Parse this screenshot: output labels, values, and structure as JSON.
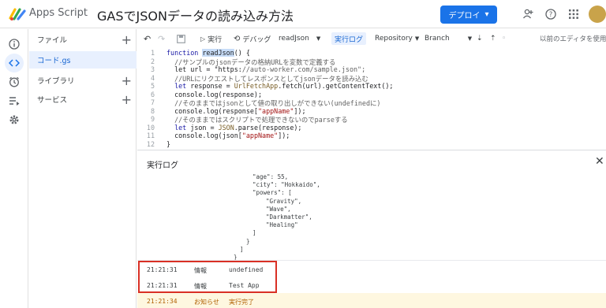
{
  "header": {
    "app_name": "Apps Script",
    "project_title": "GASでJSONデータの読み込み方法",
    "deploy_label": "デプロイ",
    "icons": [
      "add-person-icon",
      "help-icon",
      "apps-grid-icon",
      "avatar"
    ]
  },
  "rail": [
    "info-icon",
    "code-icon",
    "clock-icon",
    "run-list-icon",
    "settings-icon"
  ],
  "sidebar": {
    "files_label": "ファイル",
    "file_name": "コード.gs",
    "libraries_label": "ライブラリ",
    "services_label": "サービス"
  },
  "toolbar": {
    "run_label": "実行",
    "debug_label": "デバッグ",
    "function_name": "readJson",
    "exec_log_label": "実行ログ",
    "repository_label": "Repository",
    "branch_label": "Branch",
    "legacy_editor_label": "以前のエディタを使用"
  },
  "code": [
    {
      "n": "1",
      "text": "function readJson() {"
    },
    {
      "n": "2",
      "text": "  //サンプルのjsonデータの格納URLを変数で定義する"
    },
    {
      "n": "3",
      "text": "  let url = \"https://auto-worker.com/sample.json\";"
    },
    {
      "n": "4",
      "text": "  //URLにリクエストしてレスポンスとしてjsonデータを読み込む"
    },
    {
      "n": "5",
      "text": "  let response = UrlFetchApp.fetch(url).getContentText();"
    },
    {
      "n": "6",
      "text": "  console.log(response);"
    },
    {
      "n": "7",
      "text": "  //そのままではjsonとして値の取り出しができない(undefinedに)"
    },
    {
      "n": "8",
      "text": "  console.log(response[\"appName\"]);"
    },
    {
      "n": "9",
      "text": "  //そのままではスクリプトで処理できないのでparseする"
    },
    {
      "n": "10",
      "text": "  let json = JSON.parse(response);"
    },
    {
      "n": "11",
      "text": "  console.log(json[\"appName\"]);"
    },
    {
      "n": "12",
      "text": "}"
    }
  ],
  "log": {
    "title": "実行ログ",
    "json_lines": [
      "\"age\": 55,",
      "\"city\": \"Hokkaido\",",
      "\"powers\": [",
      "  \"Gravity\",",
      "  \"Wave\",",
      "  \"Darkmatter\",",
      "  \"Healing\"",
      "]",
      "}",
      "]",
      "}"
    ],
    "rows": [
      {
        "time": "21:21:31",
        "level": "情報",
        "message": "undefined"
      },
      {
        "time": "21:21:31",
        "level": "情報",
        "message": "Test App"
      },
      {
        "time": "21:21:34",
        "level": "お知らせ",
        "message": "実行完了"
      }
    ]
  }
}
